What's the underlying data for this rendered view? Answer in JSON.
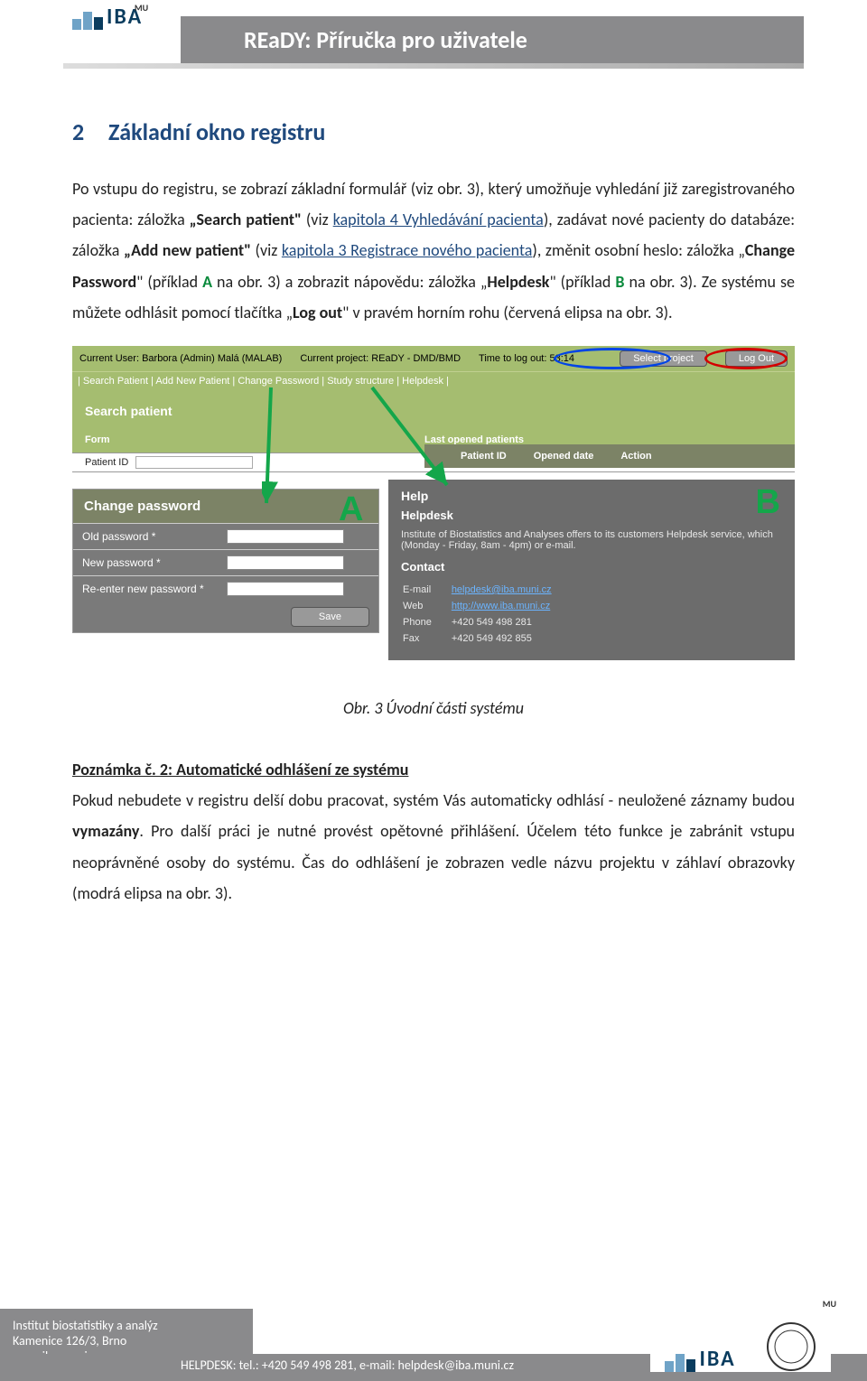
{
  "header": {
    "logo_text": "IBA",
    "logo_mu": "MU",
    "title": "REaDY:    Příručka pro uživatele"
  },
  "section": {
    "number": "2",
    "title": "Základní okno registru"
  },
  "para1_a": "Po vstupu do registru, se zobrazí základní formulář (viz ",
  "para1_b": "obr. 3",
  "para1_c": "), který umožňuje vyhledání již zaregistrovaného pacienta: záložka ",
  "para1_d": "Search patient",
  "para1_e": " (viz ",
  "link1": "kapitola 4 Vyhledávání pacienta",
  "para1_f": "), zadávat nové pacienty do databáze: záložka ",
  "para1_g": "Add new patient",
  "para1_h": " (viz ",
  "link2": "kapitola 3 Registrace nového pacienta",
  "para1_i": "), změnit osobní heslo: záložka „",
  "para1_j": "Change Password",
  "para1_k": "\" (příklad ",
  "letterA": "A",
  "para1_l": " na obr. 3) a zobrazit nápovědu: záložka „",
  "para1_m": "Helpdesk",
  "para1_n": "\" (příklad ",
  "letterB": "B",
  "para1_o": " na obr. 3). Ze systému se můžete odhlásit pomocí tlačítka „",
  "para1_p": "Log out",
  "para1_q": "\" v pravém horním rohu (červená elipsa na obr. 3).",
  "shot": {
    "current_user_label": "Current User: Barbora (Admin) Malá (MALAB)",
    "current_project_label": "Current project: REaDY - DMD/BMD",
    "time_label": "Time to log out: 53:14",
    "select_project_btn": "Select project",
    "logout_btn": "Log Out",
    "tabs": "|  Search Patient  |  Add New Patient  |  Change Password  |  Study structure  |  Helpdesk  |",
    "search_heading": "Search patient",
    "form_label": "Form",
    "last_label": "Last opened patients",
    "pid_label": "Patient ID",
    "tbl_pid": "Patient ID",
    "tbl_opened": "Opened date",
    "tbl_action": "Action",
    "panelA": {
      "title": "Change password",
      "old": "Old password *",
      "new": "New password *",
      "re": "Re-enter new password *",
      "save": "Save"
    },
    "panelB": {
      "help": "Help",
      "helpdesk": "Helpdesk",
      "desc": "Institute of Biostatistics and Analyses offers to its customers Helpdesk service, which (Monday - Friday, 8am - 4pm) or e-mail.",
      "contact": "Contact",
      "email_l": "E-mail",
      "email_v": "helpdesk@iba.muni.cz",
      "web_l": "Web",
      "web_v": "http://www.iba.muni.cz",
      "phone_l": "Phone",
      "phone_v": "+420 549 498 281",
      "fax_l": "Fax",
      "fax_v": "+420 549 492 855"
    },
    "bigA": "A",
    "bigB": "B"
  },
  "caption": "Obr. 3 Úvodní části systému",
  "note_title": "Poznámka č. 2: Automatické odhlášení ze systému",
  "note_body_a": "Pokud nebudete v registru delší dobu pracovat, systém Vás automaticky odhlásí - neuložené záznamy budou ",
  "note_body_b": "vymazány",
  "note_body_c": ". Pro další práci je nutné provést opětovné přihlášení. Účelem této funkce je zabránit vstupu neoprávněné osoby do systému. Čas do odhlášení je zobrazen vedle názvu projektu v záhlaví obrazovky (modrá elipsa na obr. 3).",
  "footer": {
    "inst": "Institut biostatistiky a analýz",
    "addr": "Kamenice 126/3, Brno",
    "web": "www.iba.muni.cz",
    "helpdesk": "HELPDESK: tel.: +420 549 498 281, e-mail: helpdesk@iba.muni.cz"
  }
}
